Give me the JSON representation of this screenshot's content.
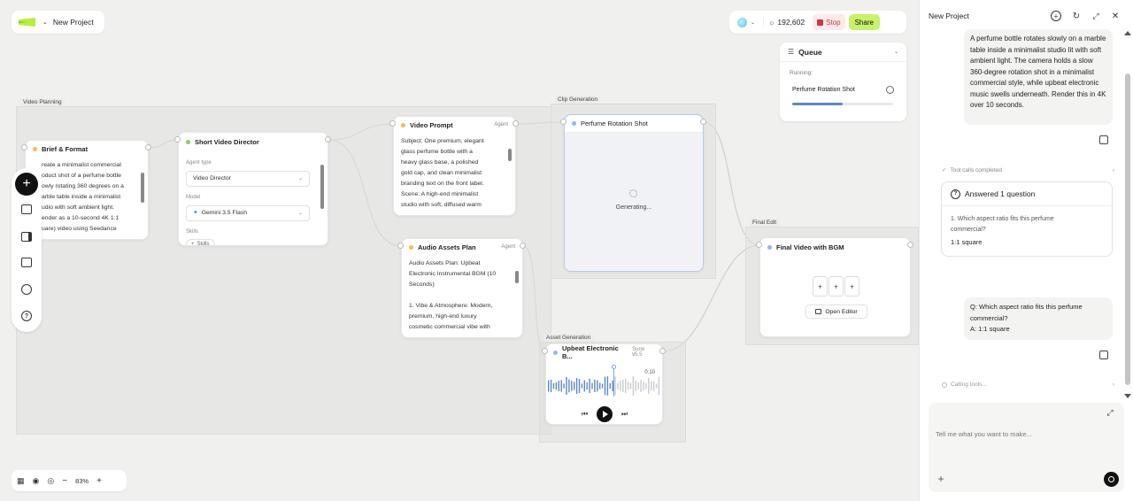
{
  "header": {
    "project_name": "New Project",
    "credits": "192,602",
    "stop_label": "Stop",
    "share_label": "Share"
  },
  "queue": {
    "title": "Queue",
    "running_label": "Running:",
    "item_name": "Perfume Rotation Shot",
    "progress": 0.5
  },
  "groups": {
    "video_planning": "Video Planning",
    "clip_generation": "Clip Generation",
    "asset_generation": "Asset Generation",
    "final_edit": "Final Edit"
  },
  "nodes": {
    "brief": {
      "title": "Brief & Format",
      "lines": [
        "reate a minimalist commercial",
        "oduct shot of a perfume bottle",
        "owly rotating 360 degrees on a",
        "arble table inside a minimalist",
        "udio with soft ambient light.",
        "ender as a 10-second 4K 1:1",
        "uare) video using Seedance"
      ]
    },
    "director": {
      "title": "Short Video Director",
      "agent_type_label": "Agent type",
      "agent_type_value": "Video Director",
      "model_label": "Model",
      "model_value": "Gemini 3.5 Flash",
      "skills_label": "Skills",
      "skills_chip": "Skills"
    },
    "video_prompt": {
      "title": "Video Prompt",
      "tag": "Agent",
      "lines": [
        "Subject: One premium, elegant",
        "glass perfume bottle with a",
        "heavy glass base, a polished",
        "gold cap, and clean minimalist",
        "branding text on the front label.",
        "Scene: A high-end minimalist",
        "studio with soft, diffused warm"
      ]
    },
    "audio_plan": {
      "title": "Audio Assets Plan",
      "tag": "Agent",
      "lines": [
        "Audio Assets Plan: Upbeat",
        "Electronic Instrumental BGM (10",
        "Seconds)",
        "",
        "1. Vibe & Atmosphere: Modern,",
        "premium, high-end luxury",
        "cosmetic commercial vibe with"
      ]
    },
    "clip": {
      "title": "Perfume Rotation Shot",
      "status": "Generating..."
    },
    "audio_track": {
      "title": "Upbeat Electronic B...",
      "tag": "Suno v5.5",
      "time": "0:10"
    },
    "final_video": {
      "title": "Final Video with BGM",
      "open_editor_label": "Open Editor"
    }
  },
  "zoom": {
    "level": "83%"
  },
  "chat": {
    "title": "New Project",
    "user_message_1": "A perfume bottle rotates slowly on a marble table inside a minimalist studio lit with soft ambient light. The camera holds a slow 360-degree rotation shot in a minimalist commercial style, while upbeat electronic music swells underneath. Render this in 4K over 10 seconds.",
    "tool_calls_label": "Tool calls completed",
    "answered_title": "Answered 1 question",
    "answered_question": "1. Which aspect ratio fits this perfume commercial?",
    "answered_answer": "1:1 square",
    "user_message_2_q": "Q: Which aspect ratio fits this perfume commercial?",
    "user_message_2_a": "A: 1:1 square",
    "calling_tools_label": "Calling tools...",
    "input_placeholder": "Tell me what you want to make..."
  },
  "colors": {
    "logo_green": "#b8ef3c",
    "share_bg": "#c7f26a",
    "stop_bg": "#c8383e",
    "progress_blue": "#5e88c4",
    "accent_blue": "#7ea0d9"
  }
}
